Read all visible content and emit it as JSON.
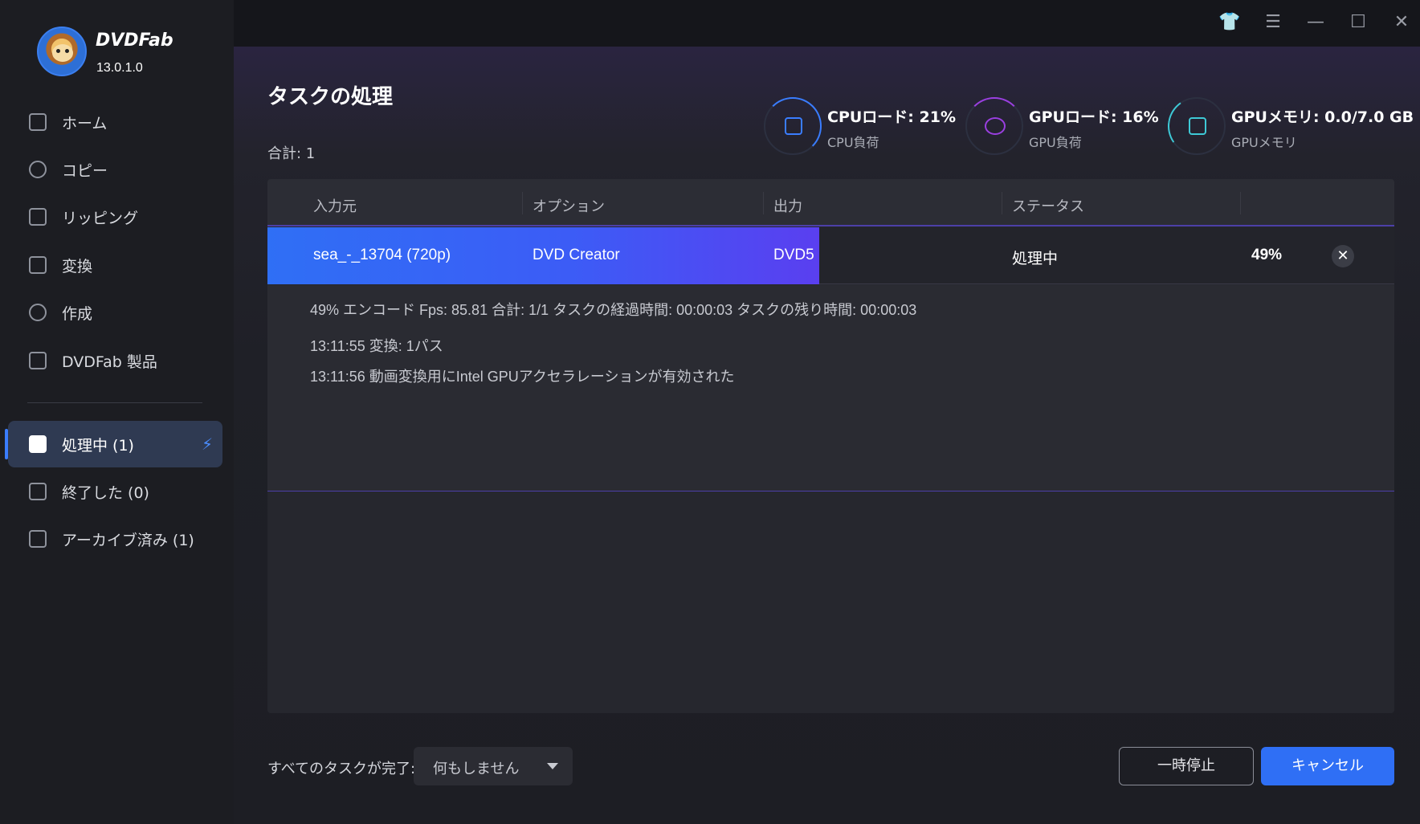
{
  "app": {
    "brand": "DVDFab",
    "version": "13.0.1.0"
  },
  "sidebar": {
    "items": [
      {
        "label": "ホーム",
        "icon": "home-icon"
      },
      {
        "label": "コピー",
        "icon": "copy-icon"
      },
      {
        "label": "リッピング",
        "icon": "ripper-icon"
      },
      {
        "label": "変換",
        "icon": "converter-icon"
      },
      {
        "label": "作成",
        "icon": "creator-icon"
      },
      {
        "label": "DVDFab 製品",
        "icon": "products-icon"
      }
    ],
    "queue": [
      {
        "label": "処理中 (1)",
        "icon": "processing-icon",
        "active": true
      },
      {
        "label": "終了した (0)",
        "icon": "finished-icon"
      },
      {
        "label": "アーカイブ済み (1)",
        "icon": "archive-icon"
      }
    ]
  },
  "main": {
    "title": "タスクの処理",
    "total": "合計: 1",
    "stats": [
      {
        "value": "CPUロード: 21%",
        "label": "CPU負荷",
        "icon": "cpu-icon",
        "percent": 21,
        "color": "#3a7dff"
      },
      {
        "value": "GPUロード: 16%",
        "label": "GPU負荷",
        "icon": "intel-gpu-icon",
        "percent": 16,
        "color": "#9a3fe0"
      },
      {
        "value": "GPUメモリ: 0.0/7.0 GB",
        "label": "GPUメモリ",
        "icon": "gpu-memory-icon",
        "percent": 0,
        "color": "#3ec9d6"
      }
    ],
    "table": {
      "columns": [
        "入力元",
        "オプション",
        "出力",
        "ステータス"
      ],
      "rows": [
        {
          "input": "sea_-_13704 (720p)",
          "option": "DVD Creator",
          "output": "DVD5",
          "status": "処理中",
          "progress_text": "49%",
          "progress": 0.49
        }
      ],
      "log": [
        "49%  エンコード  Fps: 85.81    合計: 1/1  タスクの経過時間: 00:00:03  タスクの残り時間: 00:00:03",
        "13:11:55  変換: 1パス",
        "13:11:56  動画変換用にIntel GPUアクセラレーションが有効された"
      ]
    }
  },
  "footer": {
    "label": "すべてのタスクが完了:",
    "select_value": "何もしません",
    "pause_label": "一時停止",
    "cancel_label": "キャンセル"
  },
  "colors": {
    "accent": "#2f6ff5",
    "progress_end": "#5a3ff0"
  }
}
